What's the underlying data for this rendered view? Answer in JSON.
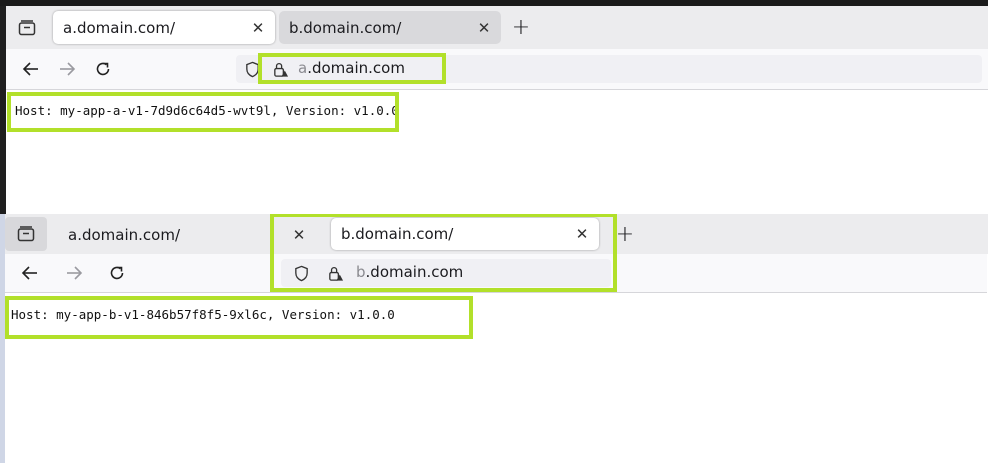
{
  "top_window": {
    "tabs": [
      {
        "label": "a.domain.com/",
        "active": true
      },
      {
        "label": "b.domain.com/",
        "active": false
      }
    ],
    "url": {
      "domain_prefix": "a",
      "domain_rest": ".domain.com"
    },
    "content": "Host: my-app-a-v1-7d9d6c64d5-wvt9l, Version: v1.0.0"
  },
  "bottom_window": {
    "tabs": [
      {
        "label": "a.domain.com/",
        "active": false
      },
      {
        "label": "b.domain.com/",
        "active": true
      }
    ],
    "url": {
      "domain_prefix": "b",
      "domain_rest": ".domain.com"
    },
    "content": "Host: my-app-b-v1-846b57f8f5-9xl6c, Version: v1.0.0"
  },
  "glyphs": {
    "close": "✕",
    "new_tab": "+"
  },
  "colors": {
    "highlight": "#b2e02a",
    "tabstrip": "#ececee",
    "navbar": "#f9f9fb"
  },
  "icons": [
    "tab-list-icon",
    "back-arrow-icon",
    "forward-arrow-icon",
    "reload-icon",
    "shield-icon",
    "lock-warning-icon",
    "close-icon",
    "plus-icon"
  ]
}
